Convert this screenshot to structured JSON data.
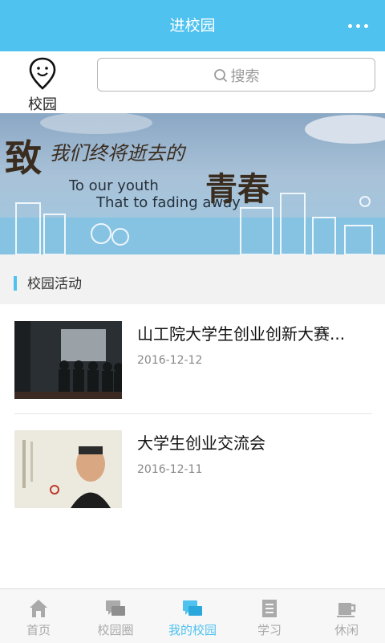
{
  "header": {
    "title": "进校园"
  },
  "campus": {
    "label": "校园"
  },
  "search": {
    "placeholder": "搜索"
  },
  "banner": {
    "big_char": "致",
    "line1": "我们终将逝去的",
    "en_line1": "To our youth",
    "en_line2": "That to fading away",
    "big2": "青春"
  },
  "section": {
    "title": "校园活动"
  },
  "activities": [
    {
      "title": "山工院大学生创业创新大赛...",
      "date": "2016-12-12"
    },
    {
      "title": "大学生创业交流会",
      "date": "2016-12-11"
    }
  ],
  "tabs": [
    {
      "label": "首页",
      "icon": "home-icon"
    },
    {
      "label": "校园圈",
      "icon": "chat-icon"
    },
    {
      "label": "我的校园",
      "icon": "chat-bubble-icon",
      "active": true
    },
    {
      "label": "学习",
      "icon": "notebook-icon"
    },
    {
      "label": "休闲",
      "icon": "coffee-cup-icon"
    }
  ],
  "colors": {
    "accent": "#4fc2ef",
    "inactive": "#aaaaaa"
  }
}
